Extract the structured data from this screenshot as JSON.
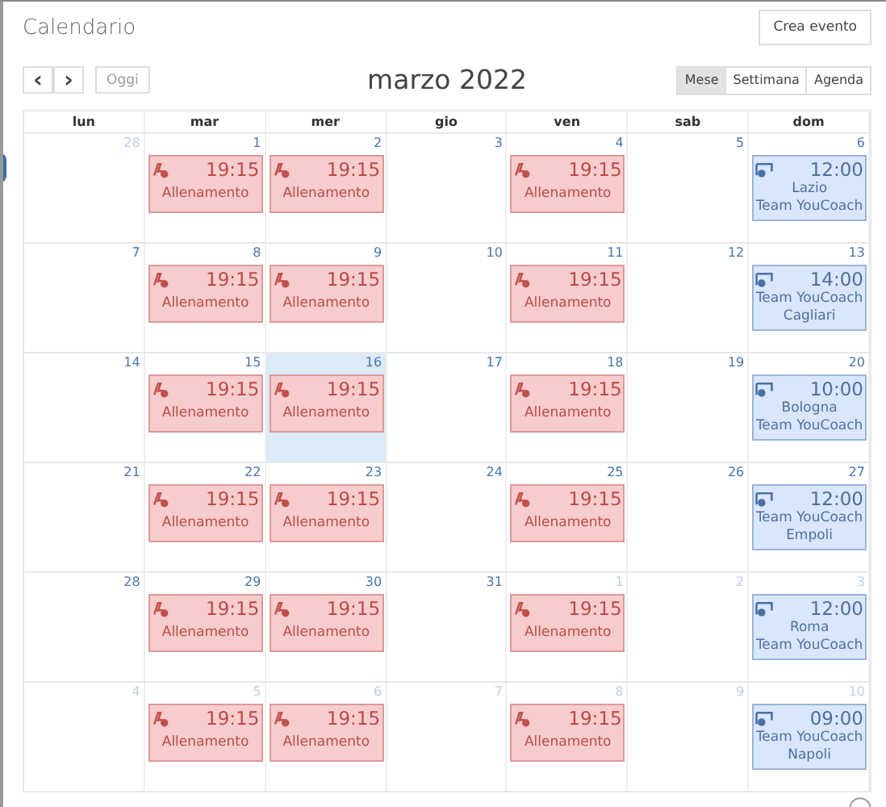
{
  "header": {
    "title": "Calendario",
    "create_button": "Crea evento"
  },
  "toolbar": {
    "prev": "‹",
    "next": "›",
    "today": "Oggi",
    "period": "marzo 2022",
    "views": [
      {
        "label": "Mese",
        "selected": true
      },
      {
        "label": "Settimana",
        "selected": false
      },
      {
        "label": "Agenda",
        "selected": false
      }
    ]
  },
  "weekdays": [
    "lun",
    "mar",
    "mer",
    "gio",
    "ven",
    "sab",
    "dom"
  ],
  "weeks": [
    {
      "days": [
        {
          "day": "28",
          "other_month": true,
          "today": false
        },
        {
          "day": "1",
          "other_month": false,
          "today": false,
          "events": [
            {
              "kind": "training",
              "time": "19:15",
              "lines": [
                "Allenamento"
              ]
            }
          ]
        },
        {
          "day": "2",
          "other_month": false,
          "today": false,
          "events": [
            {
              "kind": "training",
              "time": "19:15",
              "lines": [
                "Allenamento"
              ]
            }
          ]
        },
        {
          "day": "3",
          "other_month": false,
          "today": false
        },
        {
          "day": "4",
          "other_month": false,
          "today": false,
          "events": [
            {
              "kind": "training",
              "time": "19:15",
              "lines": [
                "Allenamento"
              ]
            }
          ]
        },
        {
          "day": "5",
          "other_month": false,
          "today": false
        },
        {
          "day": "6",
          "other_month": false,
          "today": false,
          "events": [
            {
              "kind": "match",
              "time": "12:00",
              "lines": [
                "Lazio",
                "Team YouCoach"
              ]
            }
          ]
        }
      ]
    },
    {
      "days": [
        {
          "day": "7",
          "other_month": false,
          "today": false
        },
        {
          "day": "8",
          "other_month": false,
          "today": false,
          "events": [
            {
              "kind": "training",
              "time": "19:15",
              "lines": [
                "Allenamento"
              ]
            }
          ]
        },
        {
          "day": "9",
          "other_month": false,
          "today": false,
          "events": [
            {
              "kind": "training",
              "time": "19:15",
              "lines": [
                "Allenamento"
              ]
            }
          ]
        },
        {
          "day": "10",
          "other_month": false,
          "today": false
        },
        {
          "day": "11",
          "other_month": false,
          "today": false,
          "events": [
            {
              "kind": "training",
              "time": "19:15",
              "lines": [
                "Allenamento"
              ]
            }
          ]
        },
        {
          "day": "12",
          "other_month": false,
          "today": false
        },
        {
          "day": "13",
          "other_month": false,
          "today": false,
          "events": [
            {
              "kind": "match",
              "time": "14:00",
              "lines": [
                "Team YouCoach",
                "Cagliari"
              ]
            }
          ]
        }
      ]
    },
    {
      "days": [
        {
          "day": "14",
          "other_month": false,
          "today": false
        },
        {
          "day": "15",
          "other_month": false,
          "today": false,
          "events": [
            {
              "kind": "training",
              "time": "19:15",
              "lines": [
                "Allenamento"
              ]
            }
          ]
        },
        {
          "day": "16",
          "other_month": false,
          "today": true,
          "events": [
            {
              "kind": "training",
              "time": "19:15",
              "lines": [
                "Allenamento"
              ]
            }
          ]
        },
        {
          "day": "17",
          "other_month": false,
          "today": false
        },
        {
          "day": "18",
          "other_month": false,
          "today": false,
          "events": [
            {
              "kind": "training",
              "time": "19:15",
              "lines": [
                "Allenamento"
              ]
            }
          ]
        },
        {
          "day": "19",
          "other_month": false,
          "today": false
        },
        {
          "day": "20",
          "other_month": false,
          "today": false,
          "events": [
            {
              "kind": "match",
              "time": "10:00",
              "lines": [
                "Bologna",
                "Team YouCoach"
              ]
            }
          ]
        }
      ]
    },
    {
      "days": [
        {
          "day": "21",
          "other_month": false,
          "today": false
        },
        {
          "day": "22",
          "other_month": false,
          "today": false,
          "events": [
            {
              "kind": "training",
              "time": "19:15",
              "lines": [
                "Allenamento"
              ]
            }
          ]
        },
        {
          "day": "23",
          "other_month": false,
          "today": false,
          "events": [
            {
              "kind": "training",
              "time": "19:15",
              "lines": [
                "Allenamento"
              ]
            }
          ]
        },
        {
          "day": "24",
          "other_month": false,
          "today": false
        },
        {
          "day": "25",
          "other_month": false,
          "today": false,
          "events": [
            {
              "kind": "training",
              "time": "19:15",
              "lines": [
                "Allenamento"
              ]
            }
          ]
        },
        {
          "day": "26",
          "other_month": false,
          "today": false
        },
        {
          "day": "27",
          "other_month": false,
          "today": false,
          "events": [
            {
              "kind": "match",
              "time": "12:00",
              "lines": [
                "Team YouCoach",
                "Empoli"
              ]
            }
          ]
        }
      ]
    },
    {
      "days": [
        {
          "day": "28",
          "other_month": false,
          "today": false
        },
        {
          "day": "29",
          "other_month": false,
          "today": false,
          "events": [
            {
              "kind": "training",
              "time": "19:15",
              "lines": [
                "Allenamento"
              ]
            }
          ]
        },
        {
          "day": "30",
          "other_month": false,
          "today": false,
          "events": [
            {
              "kind": "training",
              "time": "19:15",
              "lines": [
                "Allenamento"
              ]
            }
          ]
        },
        {
          "day": "31",
          "other_month": false,
          "today": false
        },
        {
          "day": "1",
          "other_month": true,
          "today": false,
          "events": [
            {
              "kind": "training",
              "time": "19:15",
              "lines": [
                "Allenamento"
              ]
            }
          ]
        },
        {
          "day": "2",
          "other_month": true,
          "today": false
        },
        {
          "day": "3",
          "other_month": true,
          "today": false,
          "events": [
            {
              "kind": "match",
              "time": "12:00",
              "lines": [
                "Roma",
                "Team YouCoach"
              ]
            }
          ]
        }
      ]
    },
    {
      "days": [
        {
          "day": "4",
          "other_month": true,
          "today": false
        },
        {
          "day": "5",
          "other_month": true,
          "today": false,
          "events": [
            {
              "kind": "training",
              "time": "19:15",
              "lines": [
                "Allenamento"
              ]
            }
          ]
        },
        {
          "day": "6",
          "other_month": true,
          "today": false,
          "events": [
            {
              "kind": "training",
              "time": "19:15",
              "lines": [
                "Allenamento"
              ]
            }
          ]
        },
        {
          "day": "7",
          "other_month": true,
          "today": false
        },
        {
          "day": "8",
          "other_month": true,
          "today": false,
          "events": [
            {
              "kind": "training",
              "time": "19:15",
              "lines": [
                "Allenamento"
              ]
            }
          ]
        },
        {
          "day": "9",
          "other_month": true,
          "today": false
        },
        {
          "day": "10",
          "other_month": true,
          "today": false,
          "events": [
            {
              "kind": "match",
              "time": "09:00",
              "lines": [
                "Team YouCoach",
                "Napoli"
              ]
            }
          ]
        }
      ]
    }
  ]
}
